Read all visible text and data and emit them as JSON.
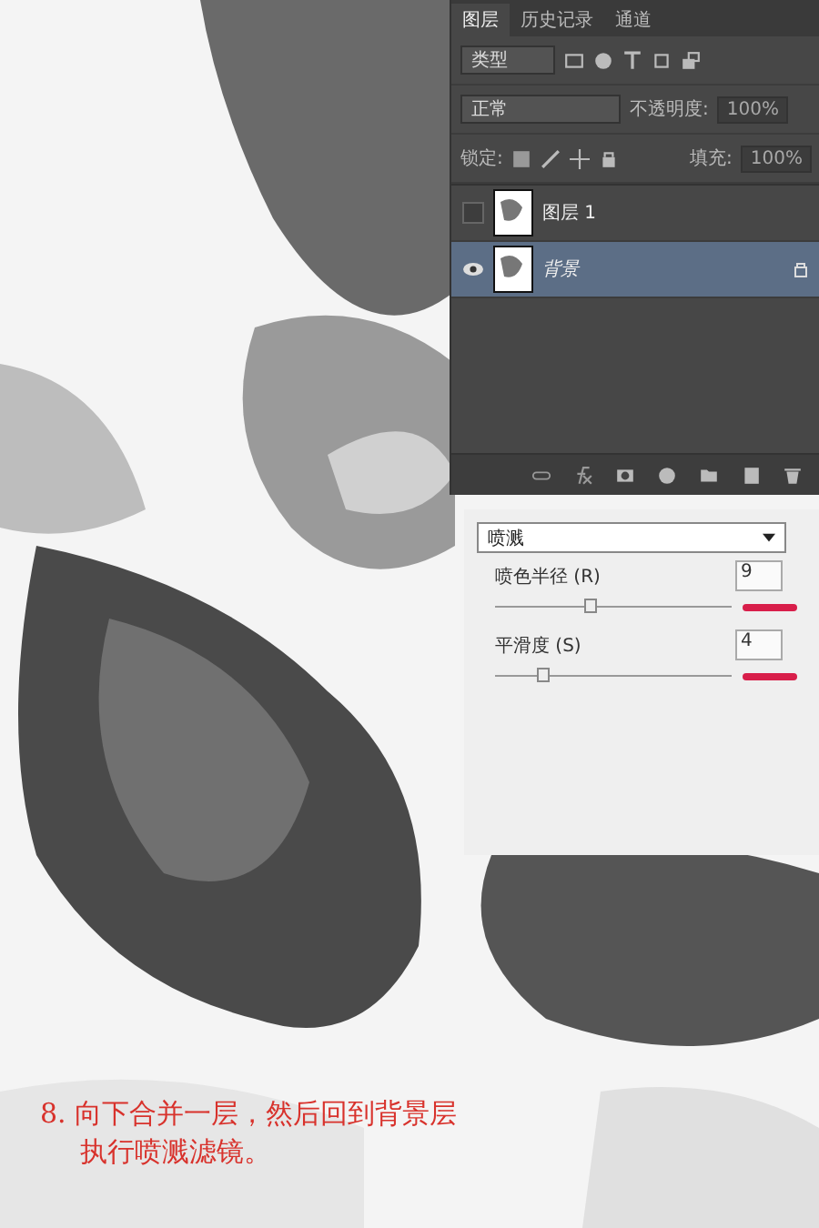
{
  "layers_panel": {
    "tabs": [
      {
        "label": "图层",
        "selected": true
      },
      {
        "label": "历史记录",
        "selected": false
      },
      {
        "label": "通道",
        "selected": false
      }
    ],
    "filter_kind": "类型",
    "blend_mode": "正常",
    "opacity_label": "不透明度:",
    "opacity": "100%",
    "lock_label": "锁定:",
    "fill_label": "填充:",
    "fill": "100%",
    "values_disabled": true,
    "layers": [
      {
        "name": "图层 1",
        "visible": false,
        "selected": false,
        "locked": false
      },
      {
        "name": "背景",
        "visible": true,
        "selected": true,
        "locked": true
      }
    ]
  },
  "filter_settings": {
    "filter": "喷溅",
    "params": [
      {
        "label": "喷色半径 (R)",
        "value": "9",
        "level": 0.4,
        "marked": true
      },
      {
        "label": "平滑度 (S)",
        "value": "4",
        "level": 0.2,
        "marked": true
      }
    ]
  },
  "caption": [
    "8. 向下合并一层，然后回到背景层",
    "执行喷溅滤镜。"
  ]
}
